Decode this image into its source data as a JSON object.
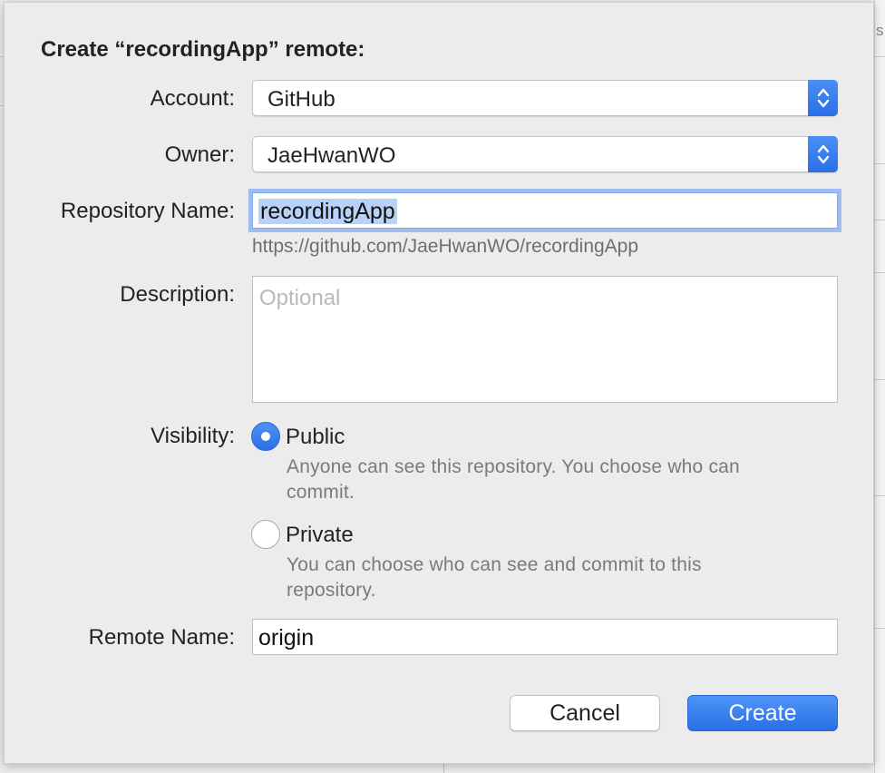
{
  "dialog": {
    "title": "Create “recordingApp” remote:",
    "account": {
      "label": "Account:",
      "value": "GitHub"
    },
    "owner": {
      "label": "Owner:",
      "value": "JaeHwanWO"
    },
    "repository": {
      "label": "Repository Name:",
      "value": "recordingApp",
      "url_hint": "https://github.com/JaeHwanWO/recordingApp"
    },
    "description": {
      "label": "Description:",
      "placeholder": "Optional"
    },
    "visibility": {
      "label": "Visibility:",
      "options": [
        {
          "label": "Public",
          "description": "Anyone can see this repository. You choose who can commit.",
          "selected": true
        },
        {
          "label": "Private",
          "description": "You can choose who can see and commit to this repository.",
          "selected": false
        }
      ]
    },
    "remote_name": {
      "label": "Remote Name:",
      "value": "origin"
    },
    "buttons": {
      "cancel": "Cancel",
      "create": "Create"
    }
  },
  "background": {
    "fragment_text": "s"
  },
  "colors": {
    "accent": "#2a6fe7",
    "selection": "#b7d1f7",
    "sheet_bg": "#ececec"
  }
}
